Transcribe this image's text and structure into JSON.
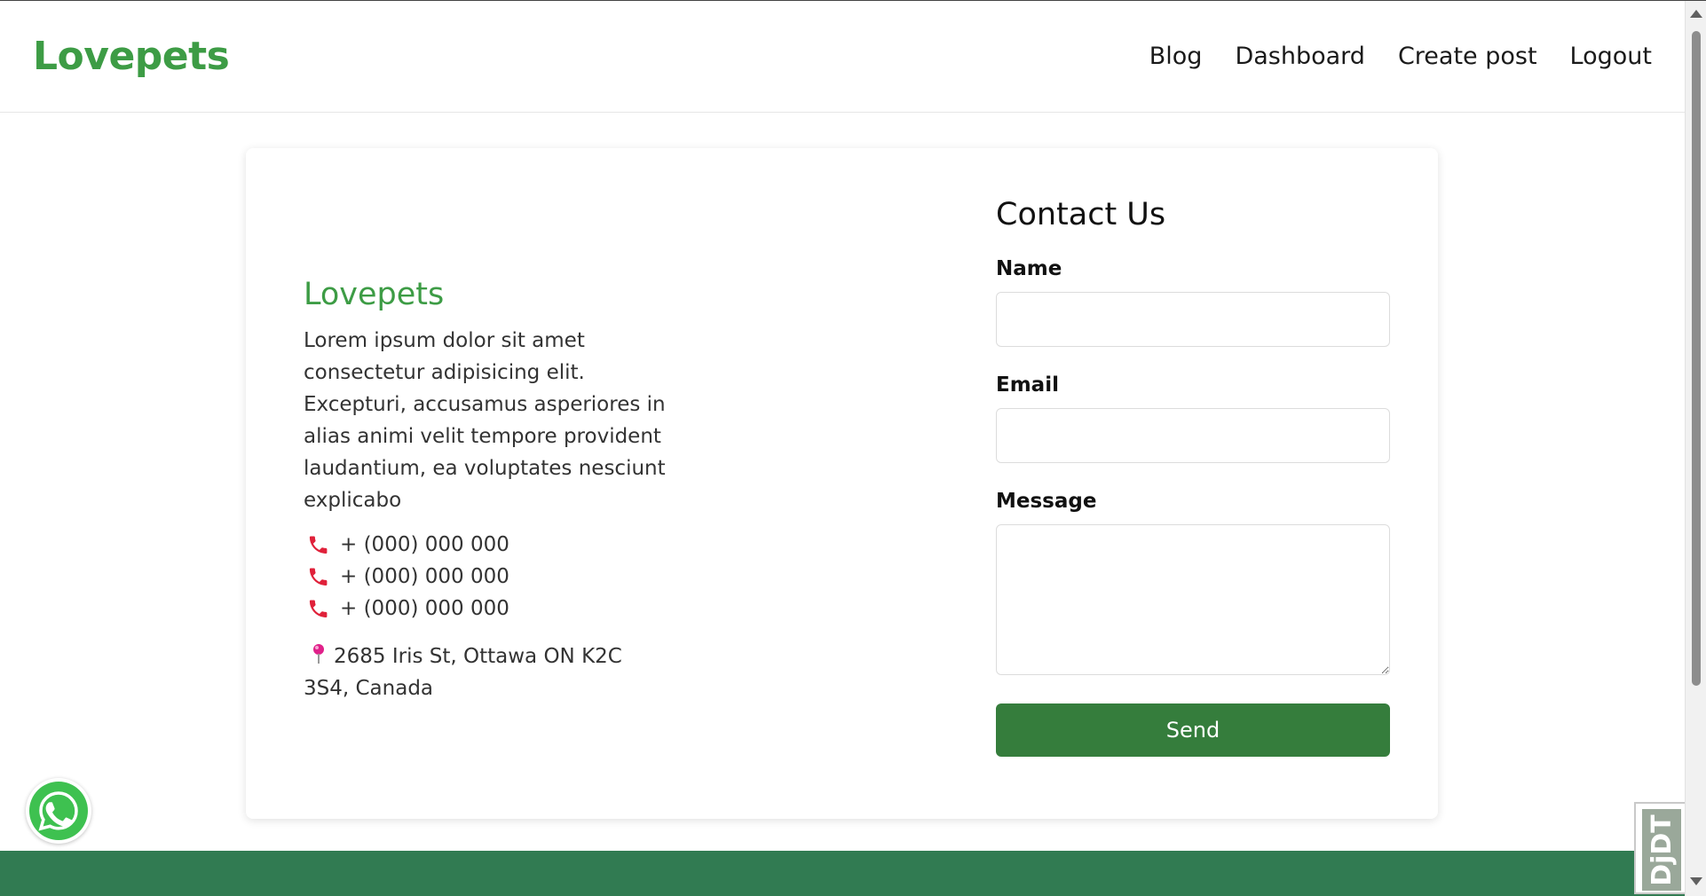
{
  "header": {
    "brand": "Lovepets",
    "nav": [
      {
        "label": "Blog"
      },
      {
        "label": "Dashboard"
      },
      {
        "label": "Create post"
      },
      {
        "label": "Logout"
      }
    ]
  },
  "about": {
    "brand": "Lovepets",
    "description": "Lorem ipsum dolor sit amet consectetur adipisicing elit. Excepturi, accusamus asperiores in alias animi velit tempore provident laudantium, ea voluptates nesciunt explicabo",
    "phones": [
      "+ (000) 000 000",
      "+ (000) 000 000",
      "+ (000) 000 000"
    ],
    "address": "2685 Iris St, Ottawa ON K2C 3S4, Canada",
    "icons": {
      "phone": "phone-icon",
      "location": "location-pin-icon"
    },
    "phone_icon_color": "#e0213a",
    "pin_icon_color": "#e0218a"
  },
  "contact_form": {
    "title": "Contact Us",
    "name_label": "Name",
    "name_value": "",
    "email_label": "Email",
    "email_value": "",
    "message_label": "Message",
    "message_value": "",
    "send_label": "Send"
  },
  "floating": {
    "whatsapp_icon": "whatsapp-icon",
    "debug_toolbar_label": "DjDT"
  },
  "colors": {
    "brand_green": "#3d9c45",
    "button_green": "#357d3c",
    "footer_green": "#317b52"
  }
}
